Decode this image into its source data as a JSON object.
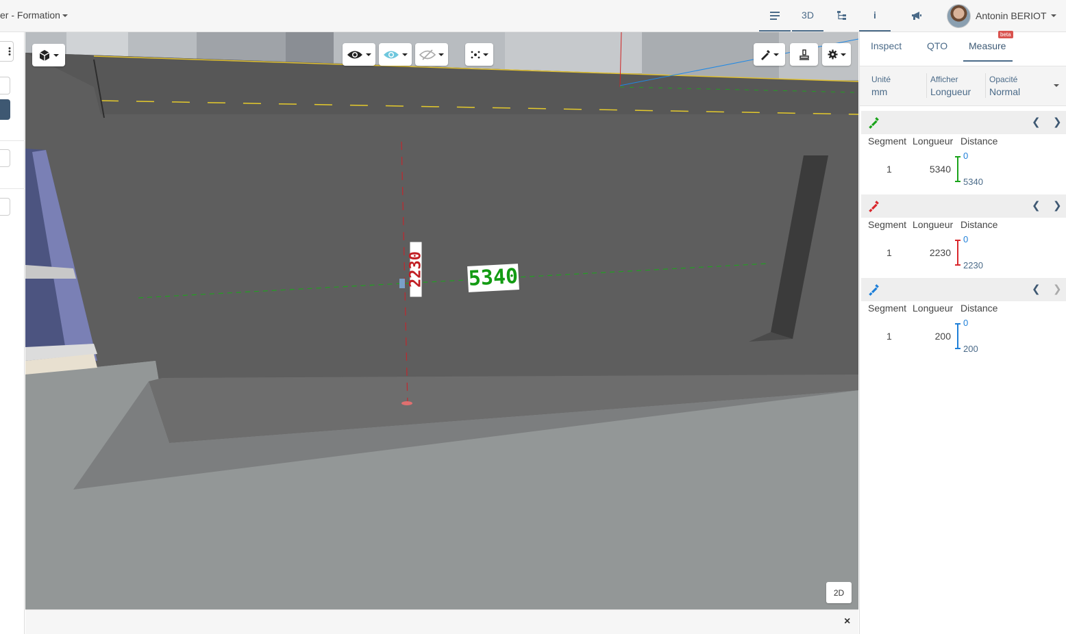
{
  "header": {
    "breadcrumb": "er - Formation",
    "tabs": [
      {
        "label": "",
        "icon": "list-icon"
      },
      {
        "label": "3D",
        "icon": ""
      },
      {
        "label": "",
        "icon": "tree-icon"
      },
      {
        "label": "i",
        "icon": "info-icon"
      },
      {
        "label": "",
        "icon": "megaphone-icon"
      }
    ],
    "user_name": "Antonin BERIOT"
  },
  "viewport": {
    "label_green": "5340",
    "label_red": "2230",
    "btn_2d": "2D",
    "close": "×"
  },
  "panel": {
    "tabs": {
      "inspect": "Inspect",
      "qto": "QTO",
      "measure": "Measure"
    },
    "beta": "beta",
    "options": {
      "unit_label": "Unité",
      "unit_value": "mm",
      "show_label": "Afficher",
      "show_value": "Longueur",
      "opacity_label": "Opacité",
      "opacity_value": "Normal"
    },
    "columns": {
      "segment": "Segment",
      "length": "Longueur",
      "distance": "Distance"
    },
    "measures": [
      {
        "color": "#1aa31a",
        "segment": "1",
        "length": "5340",
        "d_start": "0",
        "d_end": "5340"
      },
      {
        "color": "#d9262b",
        "segment": "1",
        "length": "2230",
        "d_start": "0",
        "d_end": "2230"
      },
      {
        "color": "#1e7fd8",
        "segment": "1",
        "length": "200",
        "d_start": "0",
        "d_end": "200"
      }
    ]
  },
  "colors": {
    "accent": "#4a6a88",
    "measure_green": "#1aa31a",
    "measure_red": "#d9262b",
    "measure_blue": "#1e7fd8",
    "ground": "#5f5f5f"
  }
}
